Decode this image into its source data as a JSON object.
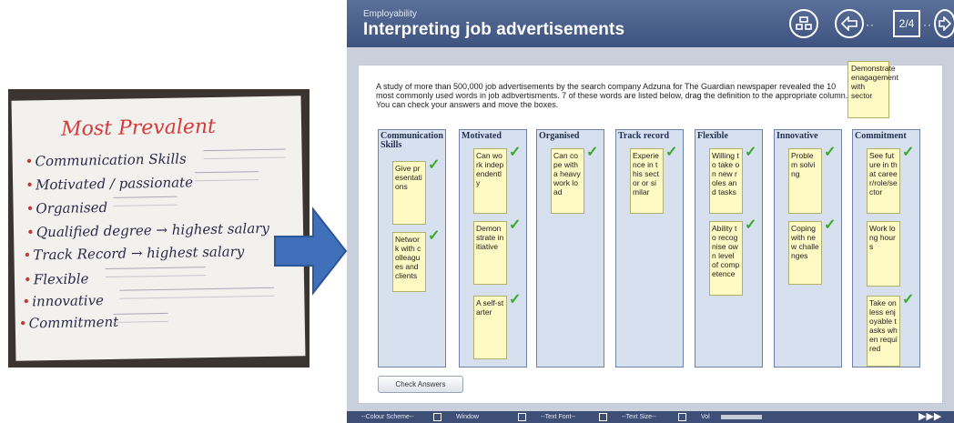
{
  "photo": {
    "title": "Most Prevalent",
    "items": [
      "Communication Skills",
      "Motivated / passionate",
      "Organised",
      "Qualified degree → highest salary",
      "Track Record → highest salary",
      "Flexible",
      "innovative",
      "Commitment"
    ]
  },
  "app": {
    "breadcrumb": "Employability",
    "title": "Interpreting job advertisements",
    "page_indicator": "2/4",
    "intro": "A study of more than 500,000 job advertisements by the search company Adzuna for The Guardian newspaper revealed the 10 most commonly used words in job adbvertisments.  7 of these words are listed below, drag the definition to the appropriate column. You can check your answers and move the boxes.",
    "unplaced_card": "Demonstrate enagagement with sector",
    "columns": [
      {
        "title": "Communication Skills",
        "cards": [
          "Give presentations",
          "Network with colleagues and clients"
        ]
      },
      {
        "title": "Motivated",
        "cards": [
          "Can work independently",
          "Demonstrate initiative",
          "A self-starter"
        ]
      },
      {
        "title": "Organised",
        "cards": [
          "Can cope with a heavy work load"
        ]
      },
      {
        "title": "Track record",
        "cards": [
          "Experience in this sector or similar"
        ]
      },
      {
        "title": "Flexible",
        "cards": [
          "Willing to take on new roles and tasks",
          "Ability to recognise own level of competence"
        ]
      },
      {
        "title": "Innovative",
        "cards": [
          "Problem solving",
          "Coping with new challenges"
        ]
      },
      {
        "title": "Commitment",
        "cards": [
          "See future in that career/role/sector",
          "Work long hours",
          "Take on less enjoyable tasks when required"
        ]
      }
    ],
    "check_button": "Check Answers",
    "footer": {
      "colour_scheme": "--Colour Scheme--",
      "window": "Window",
      "text_font": "--Text Font--",
      "text_size": "--Text Size--",
      "vol": "Vol"
    }
  },
  "colors": {
    "header": "#4a5f8c",
    "card": "#fff9c4",
    "column": "#d7e0ef",
    "check": "#3aaa2a",
    "arrow": "#3e6fb8"
  }
}
